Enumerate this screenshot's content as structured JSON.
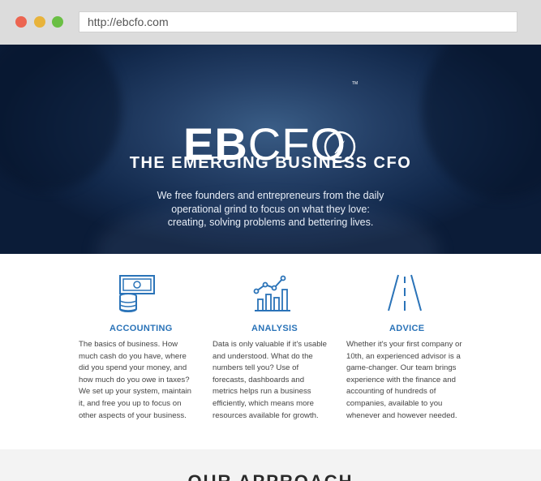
{
  "browser": {
    "url": "http://ebcfo.com"
  },
  "hero": {
    "logo_bold": "EB",
    "logo_light": "CFO",
    "compass_letter": "N",
    "trademark": "TM",
    "title": "THE EMERGING BUSINESS CFO",
    "subtitle": "We free founders and entrepreneurs from the daily operational grind to focus on what they love: creating, solving problems and bettering lives."
  },
  "features": [
    {
      "label": "ACCOUNTING",
      "icon": "money-stack-icon",
      "description": "The basics of business. How much cash do you have, where did you spend your money, and how much do you owe in taxes? We set up your system, maintain it, and free you up to focus on other aspects of your business."
    },
    {
      "label": "ANALYSIS",
      "icon": "bar-line-chart-icon",
      "description": "Data is only valuable if it's usable and understood. What do the numbers tell you? Use of forecasts, dashboards and metrics helps run a business efficiently, which means more resources available for growth."
    },
    {
      "label": "ADVICE",
      "icon": "road-icon",
      "description": "Whether it's your first company or 10th, an experienced advisor is a game-changer. Our team brings experience with the finance and accounting of hundreds of companies, available to you whenever and however needed."
    }
  ],
  "approach": {
    "title": "OUR APPROACH"
  },
  "colors": {
    "accent": "#2a73b8",
    "hero_dark": "#0b1c38"
  }
}
